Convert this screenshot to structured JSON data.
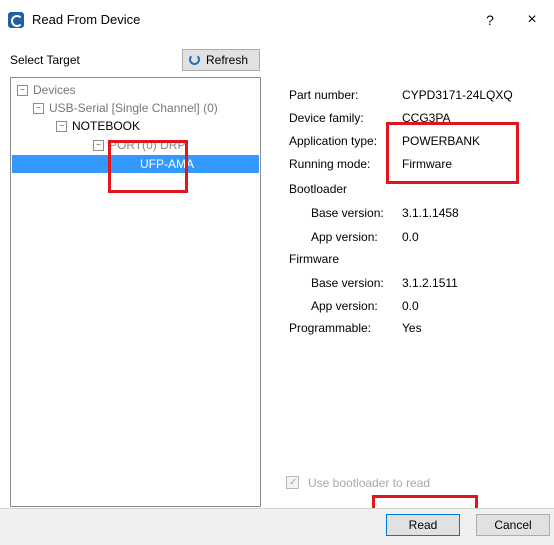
{
  "window": {
    "title": "Read From Device",
    "help": "?",
    "close": "×"
  },
  "left": {
    "header": "Select Target",
    "refresh_label": "Refresh",
    "tree": {
      "devices": "Devices",
      "usb_serial": "USB-Serial [Single Channel] (0)",
      "notebook": "NOTEBOOK",
      "port": "PORT(0) DRP",
      "ufp": "UFP-AMA"
    }
  },
  "properties": {
    "part_number": {
      "label": "Part number:",
      "value": "CYPD3171-24LQXQ"
    },
    "device_family": {
      "label": "Device family:",
      "value": "CCG3PA"
    },
    "application_type": {
      "label": "Application type:",
      "value": "POWERBANK"
    },
    "running_mode": {
      "label": "Running mode:",
      "value": "Firmware"
    },
    "bootloader": {
      "heading": "Bootloader",
      "base_version": {
        "label": "Base version:",
        "value": "3.1.1.1458"
      },
      "app_version": {
        "label": "App version:",
        "value": "0.0"
      }
    },
    "firmware": {
      "heading": "Firmware",
      "base_version": {
        "label": "Base version:",
        "value": "3.1.2.1511"
      },
      "app_version": {
        "label": "App version:",
        "value": "0.0"
      }
    },
    "programmable": {
      "label": "Programmable:",
      "value": "Yes"
    }
  },
  "use_bootloader": {
    "label": "Use bootloader to read",
    "checked": true
  },
  "buttons": {
    "read": "Read",
    "cancel": "Cancel"
  },
  "colors": {
    "selection": "#3399ff",
    "highlight_box": "#e0161f",
    "accent": "#0078d7"
  }
}
